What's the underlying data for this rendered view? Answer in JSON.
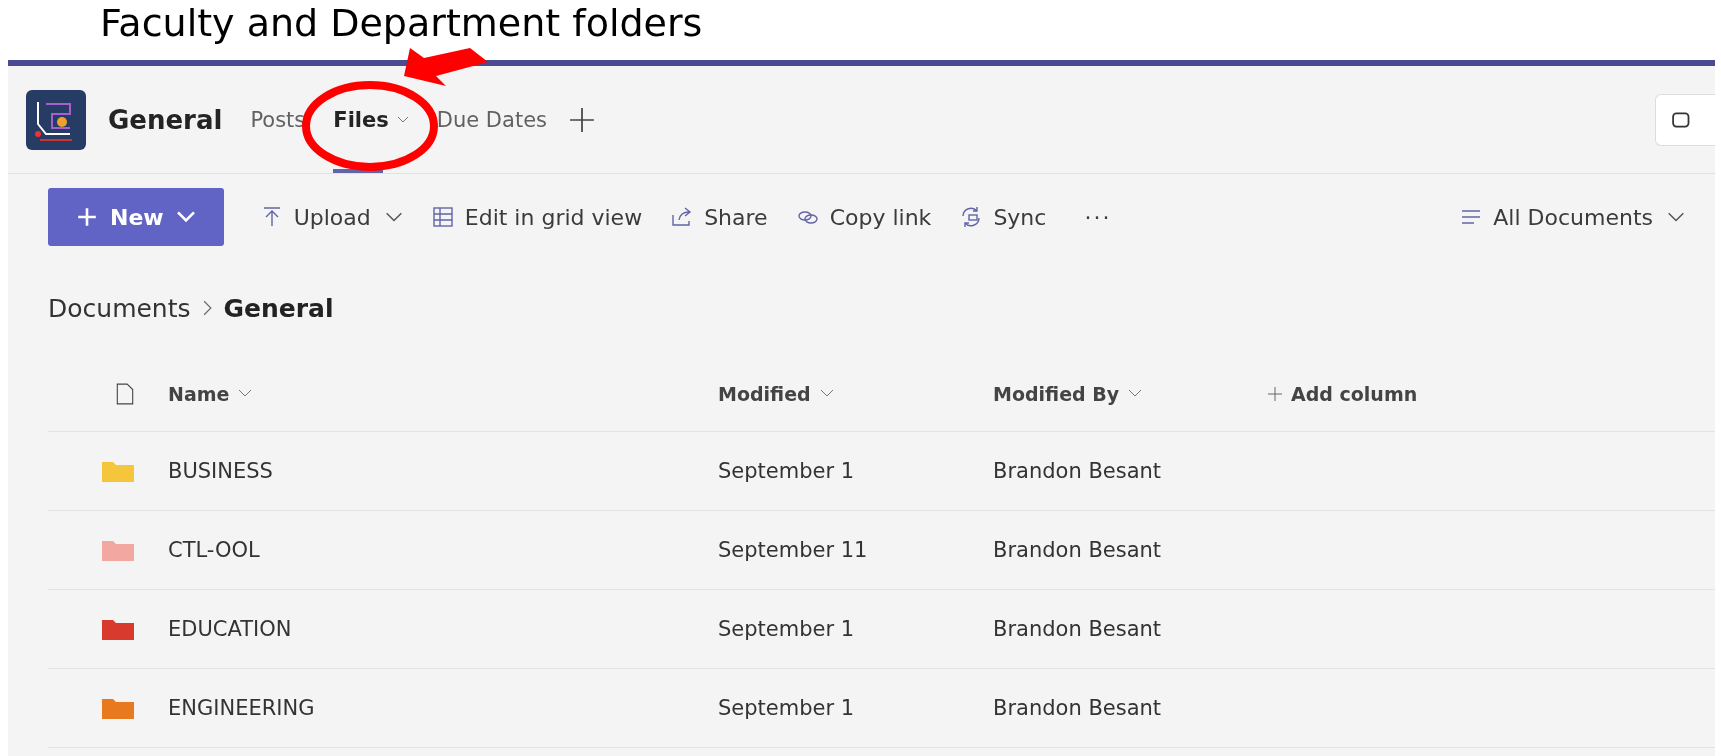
{
  "heading": "Faculty and Department folders",
  "channel": {
    "name": "General"
  },
  "tabs": [
    {
      "label": "Posts",
      "selected": false,
      "dropdown": false
    },
    {
      "label": "Files",
      "selected": true,
      "dropdown": true
    },
    {
      "label": "Due Dates",
      "selected": false,
      "dropdown": false
    }
  ],
  "toolbar": {
    "new_button": "New",
    "actions": [
      {
        "kind": "upload",
        "label": "Upload",
        "dropdown": true
      },
      {
        "kind": "grid",
        "label": "Edit in grid view",
        "dropdown": false
      },
      {
        "kind": "share",
        "label": "Share",
        "dropdown": false
      },
      {
        "kind": "link",
        "label": "Copy link",
        "dropdown": false
      },
      {
        "kind": "sync",
        "label": "Sync",
        "dropdown": false
      }
    ],
    "more": "···",
    "view": "All Documents"
  },
  "breadcrumb": [
    "Documents",
    "General"
  ],
  "table": {
    "columns": [
      "Name",
      "Modified",
      "Modified By"
    ],
    "add_column": "Add column",
    "rows": [
      {
        "name": "BUSINESS",
        "modified": "September 1",
        "modified_by": "Brandon Besant",
        "color": "#f5c53b"
      },
      {
        "name": "CTL-OOL",
        "modified": "September 11",
        "modified_by": "Brandon Besant",
        "color": "#f2a7a0"
      },
      {
        "name": "EDUCATION",
        "modified": "September 1",
        "modified_by": "Brandon Besant",
        "color": "#d83b2d"
      },
      {
        "name": "ENGINEERING",
        "modified": "September 1",
        "modified_by": "Brandon Besant",
        "color": "#e8791f"
      }
    ]
  }
}
